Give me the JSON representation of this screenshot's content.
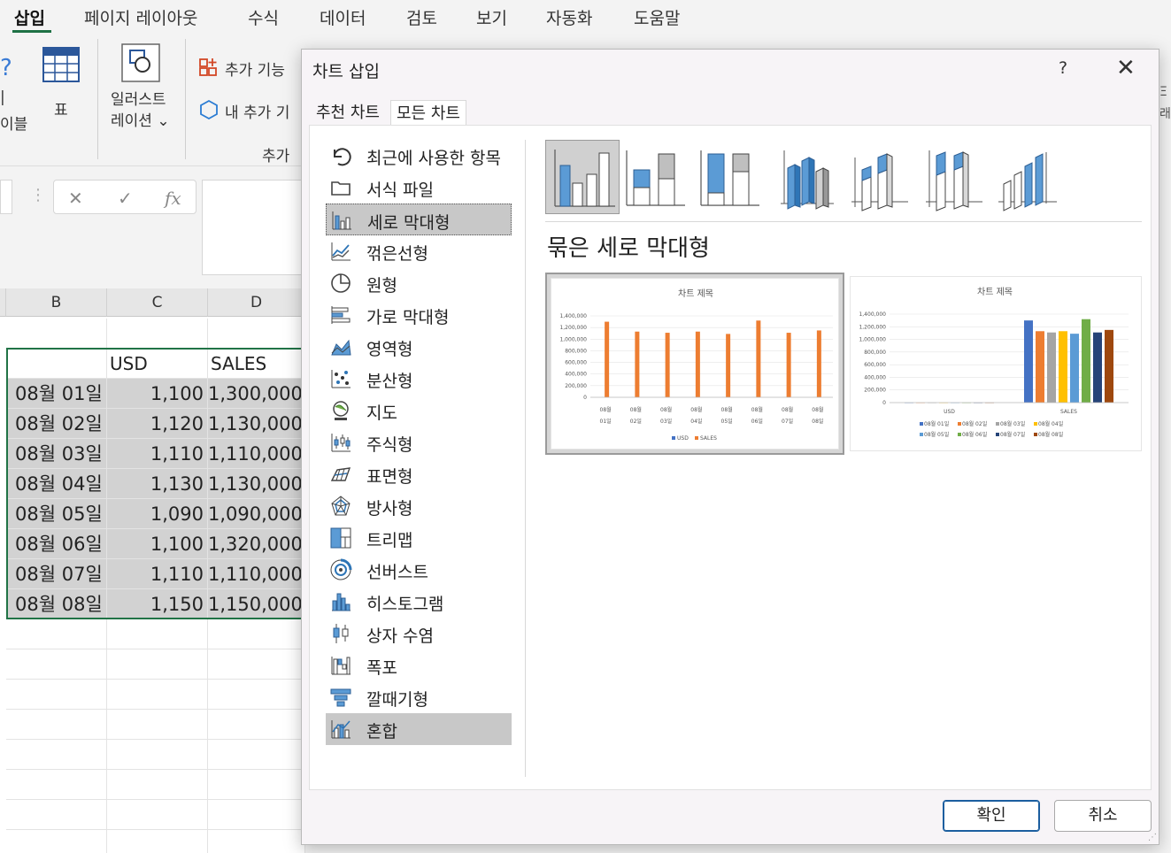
{
  "ribbon": {
    "tabs": [
      {
        "label": "삽입",
        "active": true
      },
      {
        "label": "페이지 레이아웃"
      },
      {
        "label": "수식"
      },
      {
        "label": "데이터"
      },
      {
        "label": "검토"
      },
      {
        "label": "보기"
      },
      {
        "label": "자동화"
      },
      {
        "label": "도움말"
      }
    ],
    "left_cut_label_1": "|",
    "left_cut_label_2": "이블",
    "table_label": "표",
    "illustrations_label_1": "일러스트",
    "illustrations_label_2": "레이션 ⌄",
    "get_addins_label": "추가 기능 ",
    "my_addins_label": "내 추가 기",
    "addins_group_label": "추가 ",
    "right_cut_1": "Ξ",
    "right_cut_2": "래"
  },
  "formula_bar": {
    "cancel_glyph": "✕",
    "enter_glyph": "✓",
    "fx_glyph": "fx",
    "dots": "⋮"
  },
  "sheet": {
    "columns": [
      "B",
      "C",
      "D"
    ],
    "header_row": [
      "",
      "USD",
      "SALES"
    ],
    "rows": [
      [
        "08월 01일",
        "1,100",
        "1,300,000"
      ],
      [
        "08월 02일",
        "1,120",
        "1,130,000"
      ],
      [
        "08월 03일",
        "1,110",
        "1,110,000"
      ],
      [
        "08월 04일",
        "1,130",
        "1,130,000"
      ],
      [
        "08월 05일",
        "1,090",
        "1,090,000"
      ],
      [
        "08월 06일",
        "1,100",
        "1,320,000"
      ],
      [
        "08월 07일",
        "1,110",
        "1,110,000"
      ],
      [
        "08월 08일",
        "1,150",
        "1,150,000"
      ]
    ]
  },
  "dialog": {
    "title": "차트 삽입",
    "help": "?",
    "close": "✕",
    "tabs": [
      {
        "label": "추천 차트"
      },
      {
        "label": "모든 차트",
        "active": true
      }
    ],
    "chart_types": [
      {
        "label": "최근에 사용한 항목",
        "icon": "recent-icon"
      },
      {
        "label": "서식 파일",
        "icon": "folder-icon"
      },
      {
        "label": "세로 막대형",
        "icon": "column-chart-icon",
        "selected": true
      },
      {
        "label": "꺾은선형",
        "icon": "line-chart-icon"
      },
      {
        "label": "원형",
        "icon": "pie-chart-icon"
      },
      {
        "label": "가로 막대형",
        "icon": "bar-chart-icon"
      },
      {
        "label": "영역형",
        "icon": "area-chart-icon"
      },
      {
        "label": "분산형",
        "icon": "scatter-chart-icon"
      },
      {
        "label": "지도",
        "icon": "map-chart-icon"
      },
      {
        "label": "주식형",
        "icon": "stock-chart-icon"
      },
      {
        "label": "표면형",
        "icon": "surface-chart-icon"
      },
      {
        "label": "방사형",
        "icon": "radar-chart-icon"
      },
      {
        "label": "트리맵",
        "icon": "treemap-chart-icon"
      },
      {
        "label": "선버스트",
        "icon": "sunburst-chart-icon"
      },
      {
        "label": "히스토그램",
        "icon": "histogram-chart-icon"
      },
      {
        "label": "상자 수염",
        "icon": "box-whisker-chart-icon"
      },
      {
        "label": "폭포",
        "icon": "waterfall-chart-icon"
      },
      {
        "label": "깔때기형",
        "icon": "funnel-chart-icon"
      },
      {
        "label": "혼합",
        "icon": "combo-chart-icon",
        "hovered": true
      }
    ],
    "subtype_title": "묶은 세로 막대형",
    "preview_title": "차트 제목",
    "preview1": {
      "x_labels": [
        [
          "08월",
          "01일"
        ],
        [
          "08월",
          "02일"
        ],
        [
          "08월",
          "03일"
        ],
        [
          "08월",
          "04일"
        ],
        [
          "08월",
          "05일"
        ],
        [
          "08월",
          "06일"
        ],
        [
          "08월",
          "07일"
        ],
        [
          "08월",
          "08일"
        ]
      ],
      "y_ticks": [
        "1,400,000",
        "1,200,000",
        "1,000,000",
        "800,000",
        "600,000",
        "400,000",
        "200,000",
        "0"
      ],
      "legend": [
        "USD",
        "SALES"
      ]
    },
    "preview2": {
      "x_labels": [
        "USD",
        "SALES"
      ],
      "y_ticks": [
        "1,400,000",
        "1,200,000",
        "1,000,000",
        "800,000",
        "600,000",
        "400,000",
        "200,000",
        "0"
      ],
      "legend_row1": [
        "08월 01일",
        "08월 02일",
        "08월 03일",
        "08월 04일"
      ],
      "legend_row2": [
        "08월 05일",
        "08월 06일",
        "08월 07일",
        "08월 08일"
      ]
    },
    "ok_label": "확인",
    "cancel_label": "취소",
    "colors": {
      "orange": "#ed7d31",
      "blue": "#4472c4",
      "gray": "#a5a5a5",
      "gold": "#ffc000",
      "lightblue": "#5b9bd5",
      "green": "#70ad47",
      "navy": "#264478",
      "brown": "#9e480e"
    }
  },
  "chart_data": [
    {
      "type": "bar",
      "title": "차트 제목",
      "categories": [
        "08월 01일",
        "08월 02일",
        "08월 03일",
        "08월 04일",
        "08월 05일",
        "08월 06일",
        "08월 07일",
        "08월 08일"
      ],
      "series": [
        {
          "name": "USD",
          "values": [
            1100,
            1120,
            1110,
            1130,
            1090,
            1100,
            1110,
            1150
          ]
        },
        {
          "name": "SALES",
          "values": [
            1300000,
            1130000,
            1110000,
            1130000,
            1090000,
            1320000,
            1110000,
            1150000
          ]
        }
      ],
      "ylim": [
        0,
        1400000
      ]
    },
    {
      "type": "bar",
      "title": "차트 제목",
      "categories": [
        "USD",
        "SALES"
      ],
      "series": [
        {
          "name": "08월 01일",
          "values": [
            1100,
            1300000
          ]
        },
        {
          "name": "08월 02일",
          "values": [
            1120,
            1130000
          ]
        },
        {
          "name": "08월 03일",
          "values": [
            1110,
            1110000
          ]
        },
        {
          "name": "08월 04일",
          "values": [
            1130,
            1130000
          ]
        },
        {
          "name": "08월 05일",
          "values": [
            1090,
            1090000
          ]
        },
        {
          "name": "08월 06일",
          "values": [
            1100,
            1320000
          ]
        },
        {
          "name": "08월 07일",
          "values": [
            1110,
            1110000
          ]
        },
        {
          "name": "08월 08일",
          "values": [
            1150,
            1150000
          ]
        }
      ],
      "ylim": [
        0,
        1400000
      ]
    }
  ]
}
